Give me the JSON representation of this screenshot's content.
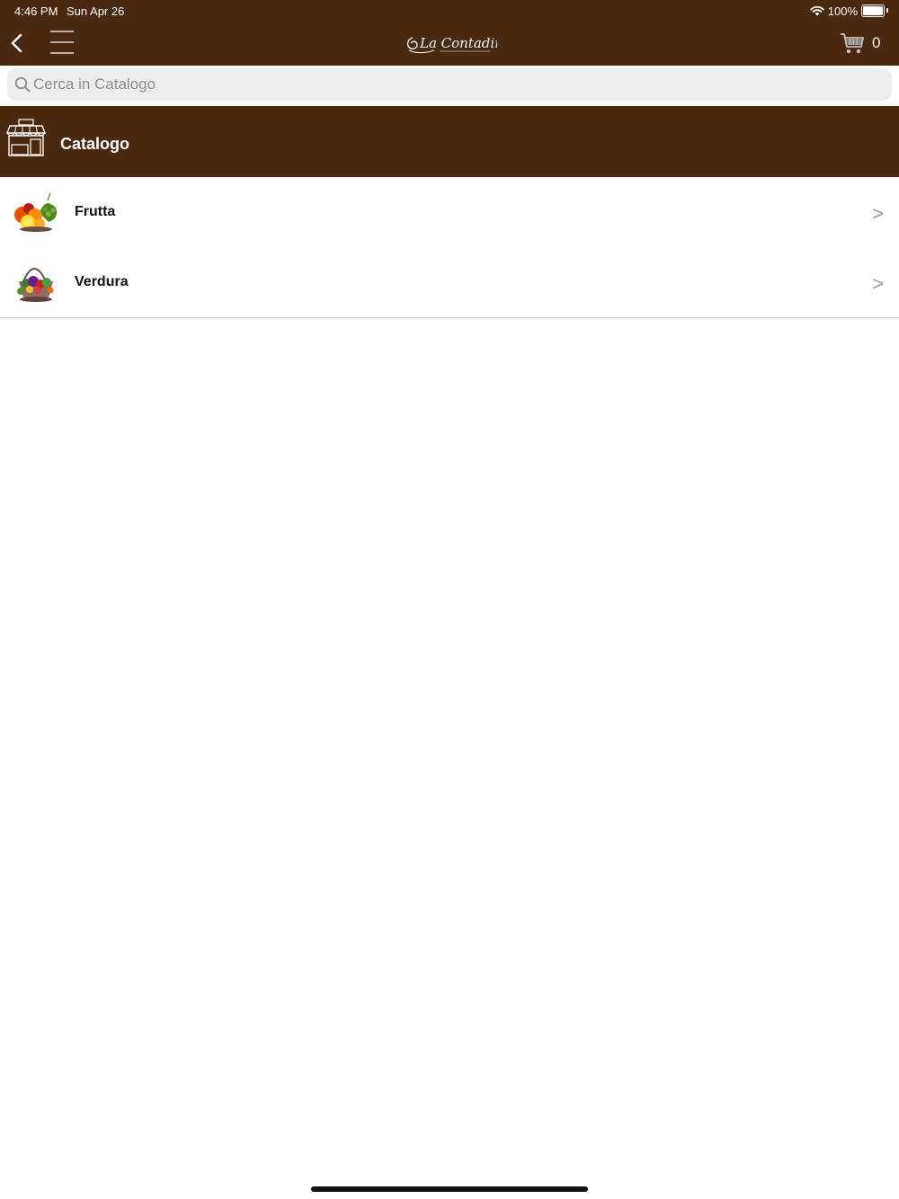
{
  "status_bar": {
    "time": "4:46 PM",
    "date": "Sun Apr 26",
    "battery": "100%",
    "battery_level": 1.0,
    "wifi_icon": "wifi-icon",
    "battery_icon": "battery-icon"
  },
  "nav_bar": {
    "back_icon": "chevron-left-icon",
    "menu_icon": "hamburger-menu-icon",
    "logo_text": "La Contadina",
    "cart_icon": "shopping-cart-icon",
    "cart_count": "0"
  },
  "search": {
    "placeholder": "Cerca in Catalogo",
    "value": "",
    "icon": "search-icon"
  },
  "catalog_header": {
    "icon": "store-icon",
    "title": "Catalogo"
  },
  "categories": [
    {
      "label": "Frutta",
      "icon": "fruit-basket-icon",
      "chevron": ">"
    },
    {
      "label": "Verdura",
      "icon": "vegetable-basket-icon",
      "chevron": ">"
    }
  ],
  "colors": {
    "brand_brown": "#4a290e",
    "search_bg": "#ededee",
    "divider": "#c8c8c8",
    "chevron": "#999999"
  }
}
